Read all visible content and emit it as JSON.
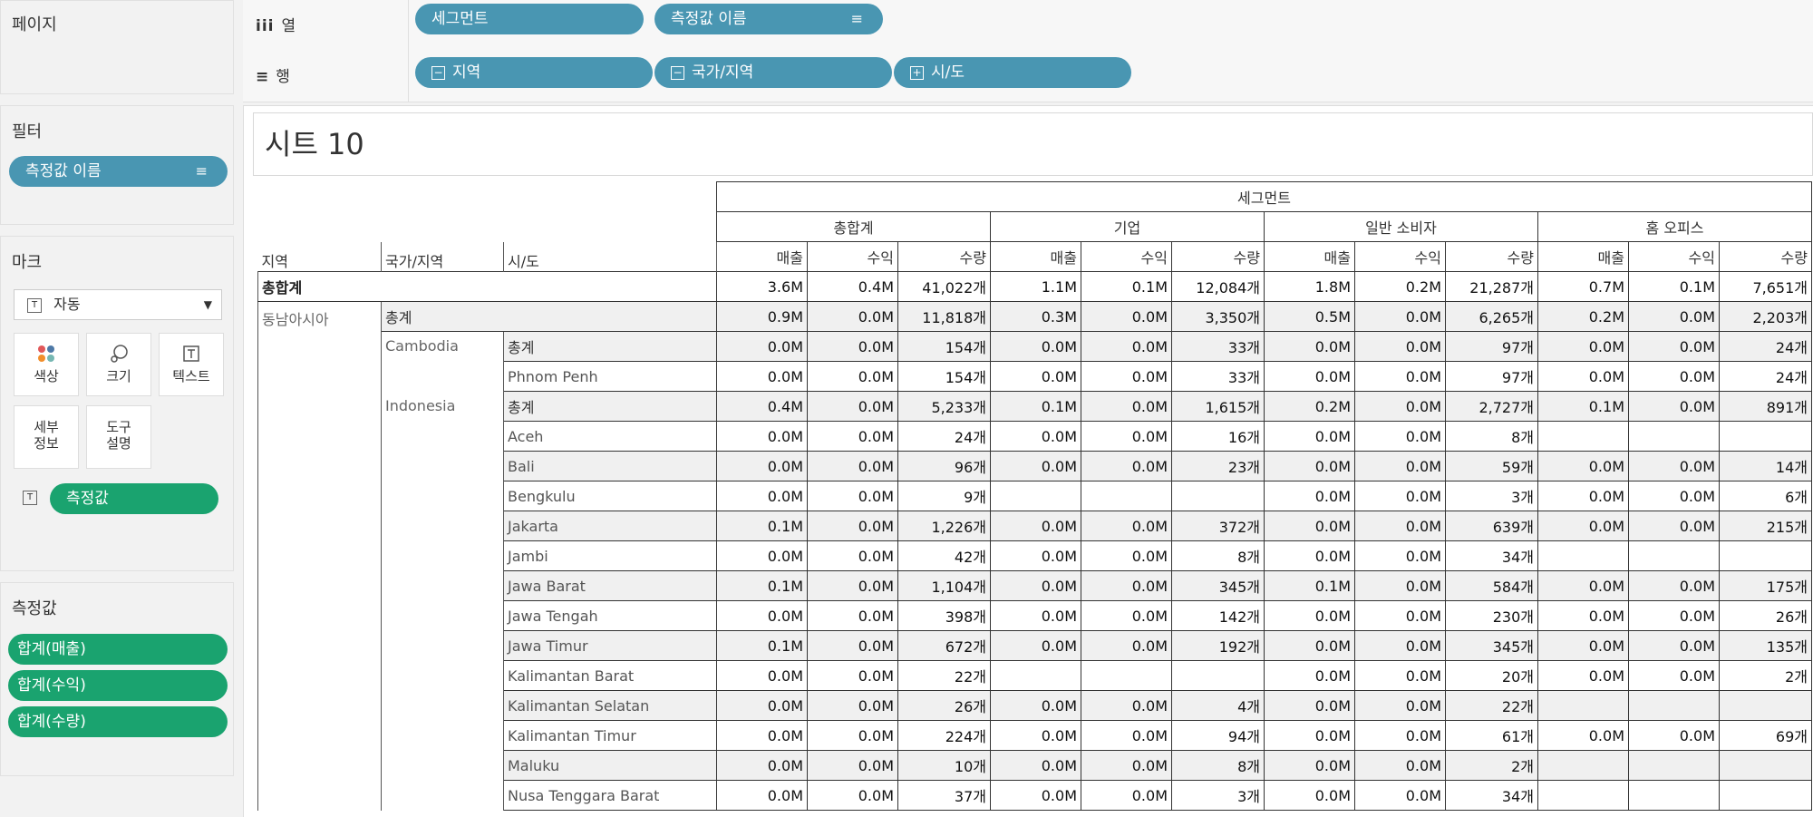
{
  "left_panel": {
    "pages_title": "페이지",
    "filters_title": "필터",
    "filter_pill": "측정값 이름",
    "marks_title": "마크",
    "marks_type": "자동",
    "marks_buttons": [
      {
        "label": "색상",
        "icon": "color-dots-icon"
      },
      {
        "label": "크기",
        "icon": "size-icon"
      },
      {
        "label": "텍스트",
        "icon": "text-icon"
      },
      {
        "label": "세부\n정보",
        "icon": "detail-icon"
      },
      {
        "label": "도구\n설명",
        "icon": "tooltip-icon"
      }
    ],
    "marks_pill": "측정값",
    "measures_title": "측정값",
    "measures": [
      "합계(매출)",
      "합계(수익)",
      "합계(수량)"
    ]
  },
  "shelves": {
    "columns_label": "열",
    "columns": [
      "세그먼트",
      "측정값 이름"
    ],
    "rows_label": "행",
    "rows": [
      "지역",
      "국가/지역",
      "시/도"
    ]
  },
  "sheet": {
    "title": "시트 10",
    "segment_header": "세그먼트",
    "dim_headers": [
      "지역",
      "국가/지역",
      "시/도"
    ],
    "groups": [
      "총합계",
      "기업",
      "일반 소비자",
      "홈 오피스"
    ],
    "measures": [
      "매출",
      "수익",
      "수량"
    ],
    "grand_total_label": "총합계",
    "region": "동남아시아",
    "subtotal_label": "총계",
    "countries": [
      "Cambodia",
      "Indonesia"
    ],
    "rows": [
      {
        "type": "grand",
        "label": "총합계",
        "values": [
          "3.6M",
          "0.4M",
          "41,022개",
          "1.1M",
          "0.1M",
          "12,084개",
          "1.8M",
          "0.2M",
          "21,287개",
          "0.7M",
          "0.1M",
          "7,651개"
        ]
      },
      {
        "type": "region-total",
        "label": "총계",
        "values": [
          "0.9M",
          "0.0M",
          "11,818개",
          "0.3M",
          "0.0M",
          "3,350개",
          "0.5M",
          "0.0M",
          "6,265개",
          "0.2M",
          "0.0M",
          "2,203개"
        ]
      },
      {
        "type": "city",
        "country": "Cambodia",
        "label": "총계",
        "bold": true,
        "values": [
          "0.0M",
          "0.0M",
          "154개",
          "0.0M",
          "0.0M",
          "33개",
          "0.0M",
          "0.0M",
          "97개",
          "0.0M",
          "0.0M",
          "24개"
        ]
      },
      {
        "type": "city",
        "label": "Phnom Penh",
        "values": [
          "0.0M",
          "0.0M",
          "154개",
          "0.0M",
          "0.0M",
          "33개",
          "0.0M",
          "0.0M",
          "97개",
          "0.0M",
          "0.0M",
          "24개"
        ]
      },
      {
        "type": "city",
        "country": "Indonesia",
        "label": "총계",
        "bold": true,
        "values": [
          "0.4M",
          "0.0M",
          "5,233개",
          "0.1M",
          "0.0M",
          "1,615개",
          "0.2M",
          "0.0M",
          "2,727개",
          "0.1M",
          "0.0M",
          "891개"
        ]
      },
      {
        "type": "city",
        "label": "Aceh",
        "values": [
          "0.0M",
          "0.0M",
          "24개",
          "0.0M",
          "0.0M",
          "16개",
          "0.0M",
          "0.0M",
          "8개",
          "",
          "",
          ""
        ]
      },
      {
        "type": "city",
        "label": "Bali",
        "values": [
          "0.0M",
          "0.0M",
          "96개",
          "0.0M",
          "0.0M",
          "23개",
          "0.0M",
          "0.0M",
          "59개",
          "0.0M",
          "0.0M",
          "14개"
        ]
      },
      {
        "type": "city",
        "label": "Bengkulu",
        "values": [
          "0.0M",
          "0.0M",
          "9개",
          "",
          "",
          "",
          "0.0M",
          "0.0M",
          "3개",
          "0.0M",
          "0.0M",
          "6개"
        ]
      },
      {
        "type": "city",
        "label": "Jakarta",
        "values": [
          "0.1M",
          "0.0M",
          "1,226개",
          "0.0M",
          "0.0M",
          "372개",
          "0.0M",
          "0.0M",
          "639개",
          "0.0M",
          "0.0M",
          "215개"
        ]
      },
      {
        "type": "city",
        "label": "Jambi",
        "values": [
          "0.0M",
          "0.0M",
          "42개",
          "0.0M",
          "0.0M",
          "8개",
          "0.0M",
          "0.0M",
          "34개",
          "",
          "",
          ""
        ]
      },
      {
        "type": "city",
        "label": "Jawa Barat",
        "values": [
          "0.1M",
          "0.0M",
          "1,104개",
          "0.0M",
          "0.0M",
          "345개",
          "0.1M",
          "0.0M",
          "584개",
          "0.0M",
          "0.0M",
          "175개"
        ]
      },
      {
        "type": "city",
        "label": "Jawa Tengah",
        "values": [
          "0.0M",
          "0.0M",
          "398개",
          "0.0M",
          "0.0M",
          "142개",
          "0.0M",
          "0.0M",
          "230개",
          "0.0M",
          "0.0M",
          "26개"
        ]
      },
      {
        "type": "city",
        "label": "Jawa Timur",
        "values": [
          "0.1M",
          "0.0M",
          "672개",
          "0.0M",
          "0.0M",
          "192개",
          "0.0M",
          "0.0M",
          "345개",
          "0.0M",
          "0.0M",
          "135개"
        ]
      },
      {
        "type": "city",
        "label": "Kalimantan Barat",
        "values": [
          "0.0M",
          "0.0M",
          "22개",
          "",
          "",
          "",
          "0.0M",
          "0.0M",
          "20개",
          "0.0M",
          "0.0M",
          "2개"
        ]
      },
      {
        "type": "city",
        "label": "Kalimantan Selatan",
        "values": [
          "0.0M",
          "0.0M",
          "26개",
          "0.0M",
          "0.0M",
          "4개",
          "0.0M",
          "0.0M",
          "22개",
          "",
          "",
          ""
        ]
      },
      {
        "type": "city",
        "label": "Kalimantan Timur",
        "values": [
          "0.0M",
          "0.0M",
          "224개",
          "0.0M",
          "0.0M",
          "94개",
          "0.0M",
          "0.0M",
          "61개",
          "0.0M",
          "0.0M",
          "69개"
        ]
      },
      {
        "type": "city",
        "label": "Maluku",
        "values": [
          "0.0M",
          "0.0M",
          "10개",
          "0.0M",
          "0.0M",
          "8개",
          "0.0M",
          "0.0M",
          "2개",
          "",
          "",
          ""
        ]
      },
      {
        "type": "city",
        "label": "Nusa Tenggara Barat",
        "values": [
          "0.0M",
          "0.0M",
          "37개",
          "0.0M",
          "0.0M",
          "3개",
          "0.0M",
          "0.0M",
          "34개",
          "",
          "",
          ""
        ]
      }
    ]
  }
}
